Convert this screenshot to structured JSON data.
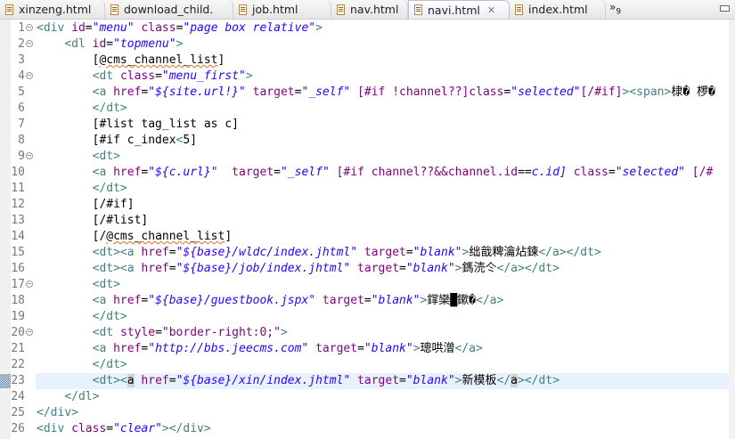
{
  "tabs": [
    {
      "label": "xinzeng.html",
      "active": false
    },
    {
      "label": "download_child.",
      "active": false
    },
    {
      "label": "job.html",
      "active": false
    },
    {
      "label": "nav.html",
      "active": false
    },
    {
      "label": "navi.html",
      "active": true
    },
    {
      "label": "index.html",
      "active": false
    }
  ],
  "more_tabs": {
    "glyph": "»",
    "count": "9"
  },
  "close_glyph": "✕",
  "current_line": 23,
  "lines": [
    {
      "n": "1",
      "fold": true,
      "tokens": [
        [
          "t",
          "<div "
        ],
        [
          "a",
          "id"
        ],
        [
          "x",
          "="
        ],
        [
          "v",
          "\"menu\""
        ],
        [
          "a",
          " class"
        ],
        [
          "x",
          "="
        ],
        [
          "v",
          "\"page box relative\""
        ],
        [
          "t",
          ">"
        ]
      ]
    },
    {
      "n": "2",
      "fold": true,
      "tokens": [
        [
          "x",
          "    "
        ],
        [
          "t",
          "<dl "
        ],
        [
          "a",
          "id"
        ],
        [
          "x",
          "="
        ],
        [
          "v",
          "\"topmenu\""
        ],
        [
          "t",
          ">"
        ]
      ]
    },
    {
      "n": "3",
      "tokens": [
        [
          "x",
          "        ["
        ],
        [
          "sq",
          "@cms_channel_list"
        ],
        [
          "x",
          "]"
        ]
      ]
    },
    {
      "n": "4",
      "fold": true,
      "tokens": [
        [
          "x",
          "        "
        ],
        [
          "t",
          "<dt "
        ],
        [
          "a",
          "class"
        ],
        [
          "x",
          "="
        ],
        [
          "v",
          "\"menu_first\""
        ],
        [
          "t",
          ">"
        ]
      ]
    },
    {
      "n": "5",
      "tokens": [
        [
          "x",
          "        "
        ],
        [
          "t",
          "<a "
        ],
        [
          "a",
          "href"
        ],
        [
          "x",
          "="
        ],
        [
          "v",
          "\"${site.url!}\""
        ],
        [
          "a",
          " target"
        ],
        [
          "x",
          "="
        ],
        [
          "v",
          "\"_self\""
        ],
        [
          "a",
          " [#if !channel??]class"
        ],
        [
          "x",
          "="
        ],
        [
          "v",
          "\"selected\""
        ],
        [
          "a",
          "[/#if]"
        ],
        [
          "t",
          "><span>"
        ],
        [
          "x",
          "棣� 椤�"
        ]
      ]
    },
    {
      "n": "6",
      "tokens": [
        [
          "x",
          "        "
        ],
        [
          "t",
          "</dt>"
        ]
      ]
    },
    {
      "n": "7",
      "tokens": [
        [
          "x",
          "        [#list tag_list as c]"
        ]
      ]
    },
    {
      "n": "8",
      "tokens": [
        [
          "x",
          "        [#if c_index"
        ],
        [
          "t",
          "<"
        ],
        [
          "x",
          "5]"
        ]
      ]
    },
    {
      "n": "9",
      "fold": true,
      "tokens": [
        [
          "x",
          "        "
        ],
        [
          "t",
          "<dt>"
        ]
      ]
    },
    {
      "n": "10",
      "tokens": [
        [
          "x",
          "        "
        ],
        [
          "t",
          "<a "
        ],
        [
          "a",
          "href"
        ],
        [
          "x",
          "="
        ],
        [
          "v",
          "\"${c.url}\""
        ],
        [
          "a",
          "  target"
        ],
        [
          "x",
          "="
        ],
        [
          "v",
          "\"_self\""
        ],
        [
          "a",
          " [#if channel??&&channel.id"
        ],
        [
          "x",
          "=="
        ],
        [
          "v",
          "c.id]"
        ],
        [
          "a",
          " class"
        ],
        [
          "x",
          "="
        ],
        [
          "v",
          "\"selected\""
        ],
        [
          "a",
          " [/#"
        ]
      ]
    },
    {
      "n": "11",
      "tokens": [
        [
          "x",
          "        "
        ],
        [
          "t",
          "</dt>"
        ]
      ]
    },
    {
      "n": "12",
      "tokens": [
        [
          "x",
          "        [/#if]"
        ]
      ]
    },
    {
      "n": "13",
      "tokens": [
        [
          "x",
          "        [/#list]"
        ]
      ]
    },
    {
      "n": "14",
      "tokens": [
        [
          "x",
          "        [/"
        ],
        [
          "sq",
          "@cms_channel_list"
        ],
        [
          "x",
          "]"
        ]
      ]
    },
    {
      "n": "15",
      "tokens": [
        [
          "x",
          "        "
        ],
        [
          "t",
          "<dt><a "
        ],
        [
          "a",
          "href"
        ],
        [
          "x",
          "="
        ],
        [
          "v",
          "\"${base}/wldc/index.jhtml\""
        ],
        [
          "a",
          " target"
        ],
        [
          "x",
          "="
        ],
        [
          "v",
          "\"blank\""
        ],
        [
          "t",
          ">"
        ],
        [
          "x",
          "绌戠粺瀹炶鍊"
        ],
        [
          "t",
          "</a></dt>"
        ]
      ]
    },
    {
      "n": "16",
      "tokens": [
        [
          "x",
          "        "
        ],
        [
          "t",
          "<dt><a "
        ],
        [
          "a",
          "href"
        ],
        [
          "x",
          "="
        ],
        [
          "v",
          "\"${base}/job/index.jhtml\""
        ],
        [
          "a",
          " target"
        ],
        [
          "x",
          "="
        ],
        [
          "v",
          "\"blank\""
        ],
        [
          "t",
          ">"
        ],
        [
          "x",
          "鎷涜仒"
        ],
        [
          "t",
          "</a></dt>"
        ]
      ]
    },
    {
      "n": "17",
      "fold": true,
      "tokens": [
        [
          "x",
          "        "
        ],
        [
          "t",
          "<dt>"
        ]
      ]
    },
    {
      "n": "18",
      "tokens": [
        [
          "x",
          "        "
        ],
        [
          "t",
          "<a "
        ],
        [
          "a",
          "href"
        ],
        [
          "x",
          "="
        ],
        [
          "v",
          "\"${base}/guestbook.jspx\""
        ],
        [
          "a",
          " target"
        ],
        [
          "x",
          "="
        ],
        [
          "v",
          "\"blank\""
        ],
        [
          "t",
          ">"
        ],
        [
          "x",
          "鐣欒█鏉�"
        ],
        [
          "t",
          "</a>"
        ]
      ]
    },
    {
      "n": "19",
      "tokens": [
        [
          "x",
          "        "
        ],
        [
          "t",
          "</dt>"
        ]
      ]
    },
    {
      "n": "20",
      "fold": true,
      "tokens": [
        [
          "x",
          "        "
        ],
        [
          "t",
          "<dt "
        ],
        [
          "a",
          "style"
        ],
        [
          "x",
          "="
        ],
        [
          "s",
          "\"border-right:0;\""
        ],
        [
          "t",
          ">"
        ]
      ]
    },
    {
      "n": "21",
      "tokens": [
        [
          "x",
          "        "
        ],
        [
          "t",
          "<a "
        ],
        [
          "a",
          "href"
        ],
        [
          "x",
          "="
        ],
        [
          "v",
          "\"http://bbs.jeecms.com\""
        ],
        [
          "a",
          " target"
        ],
        [
          "x",
          "="
        ],
        [
          "v",
          "\"blank\""
        ],
        [
          "t",
          ">"
        ],
        [
          "x",
          "璁哄潧"
        ],
        [
          "t",
          "</a>"
        ]
      ]
    },
    {
      "n": "22",
      "tokens": [
        [
          "x",
          "        "
        ],
        [
          "t",
          "</dt>"
        ]
      ]
    },
    {
      "n": "23",
      "tokens": [
        [
          "x",
          "        "
        ],
        [
          "t",
          "<dt><"
        ],
        [
          "sel",
          "a"
        ],
        [
          "a",
          " href"
        ],
        [
          "x",
          "="
        ],
        [
          "v",
          "\"${base}/xin/index.jhtml\""
        ],
        [
          "a",
          " target"
        ],
        [
          "x",
          "="
        ],
        [
          "v",
          "\"blank\""
        ],
        [
          "t",
          ">"
        ],
        [
          "x",
          "新模板"
        ],
        [
          "t",
          "</"
        ],
        [
          "sel",
          "a"
        ],
        [
          "t",
          "></dt>"
        ]
      ]
    },
    {
      "n": "24",
      "tokens": [
        [
          "x",
          "    "
        ],
        [
          "t",
          "</dl>"
        ]
      ]
    },
    {
      "n": "25",
      "tokens": [
        [
          "t",
          "</div>"
        ]
      ]
    },
    {
      "n": "26",
      "tokens": [
        [
          "t",
          "<div "
        ],
        [
          "a",
          "class"
        ],
        [
          "x",
          "="
        ],
        [
          "v",
          "\"clear\""
        ],
        [
          "t",
          "></div>"
        ]
      ]
    }
  ]
}
